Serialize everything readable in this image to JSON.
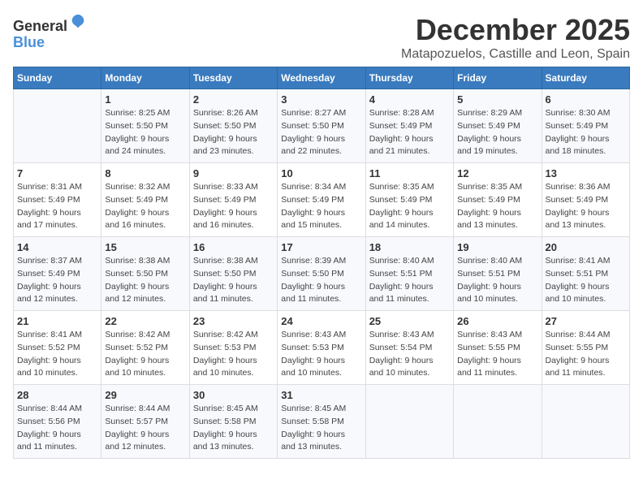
{
  "logo": {
    "line1": "General",
    "line2": "Blue"
  },
  "title": "December 2025",
  "subtitle": "Matapozuelos, Castille and Leon, Spain",
  "weekdays": [
    "Sunday",
    "Monday",
    "Tuesday",
    "Wednesday",
    "Thursday",
    "Friday",
    "Saturday"
  ],
  "weeks": [
    [
      {
        "day": "",
        "info": ""
      },
      {
        "day": "1",
        "info": "Sunrise: 8:25 AM\nSunset: 5:50 PM\nDaylight: 9 hours\nand 24 minutes."
      },
      {
        "day": "2",
        "info": "Sunrise: 8:26 AM\nSunset: 5:50 PM\nDaylight: 9 hours\nand 23 minutes."
      },
      {
        "day": "3",
        "info": "Sunrise: 8:27 AM\nSunset: 5:50 PM\nDaylight: 9 hours\nand 22 minutes."
      },
      {
        "day": "4",
        "info": "Sunrise: 8:28 AM\nSunset: 5:49 PM\nDaylight: 9 hours\nand 21 minutes."
      },
      {
        "day": "5",
        "info": "Sunrise: 8:29 AM\nSunset: 5:49 PM\nDaylight: 9 hours\nand 19 minutes."
      },
      {
        "day": "6",
        "info": "Sunrise: 8:30 AM\nSunset: 5:49 PM\nDaylight: 9 hours\nand 18 minutes."
      }
    ],
    [
      {
        "day": "7",
        "info": "Sunrise: 8:31 AM\nSunset: 5:49 PM\nDaylight: 9 hours\nand 17 minutes."
      },
      {
        "day": "8",
        "info": "Sunrise: 8:32 AM\nSunset: 5:49 PM\nDaylight: 9 hours\nand 16 minutes."
      },
      {
        "day": "9",
        "info": "Sunrise: 8:33 AM\nSunset: 5:49 PM\nDaylight: 9 hours\nand 16 minutes."
      },
      {
        "day": "10",
        "info": "Sunrise: 8:34 AM\nSunset: 5:49 PM\nDaylight: 9 hours\nand 15 minutes."
      },
      {
        "day": "11",
        "info": "Sunrise: 8:35 AM\nSunset: 5:49 PM\nDaylight: 9 hours\nand 14 minutes."
      },
      {
        "day": "12",
        "info": "Sunrise: 8:35 AM\nSunset: 5:49 PM\nDaylight: 9 hours\nand 13 minutes."
      },
      {
        "day": "13",
        "info": "Sunrise: 8:36 AM\nSunset: 5:49 PM\nDaylight: 9 hours\nand 13 minutes."
      }
    ],
    [
      {
        "day": "14",
        "info": "Sunrise: 8:37 AM\nSunset: 5:49 PM\nDaylight: 9 hours\nand 12 minutes."
      },
      {
        "day": "15",
        "info": "Sunrise: 8:38 AM\nSunset: 5:50 PM\nDaylight: 9 hours\nand 12 minutes."
      },
      {
        "day": "16",
        "info": "Sunrise: 8:38 AM\nSunset: 5:50 PM\nDaylight: 9 hours\nand 11 minutes."
      },
      {
        "day": "17",
        "info": "Sunrise: 8:39 AM\nSunset: 5:50 PM\nDaylight: 9 hours\nand 11 minutes."
      },
      {
        "day": "18",
        "info": "Sunrise: 8:40 AM\nSunset: 5:51 PM\nDaylight: 9 hours\nand 11 minutes."
      },
      {
        "day": "19",
        "info": "Sunrise: 8:40 AM\nSunset: 5:51 PM\nDaylight: 9 hours\nand 10 minutes."
      },
      {
        "day": "20",
        "info": "Sunrise: 8:41 AM\nSunset: 5:51 PM\nDaylight: 9 hours\nand 10 minutes."
      }
    ],
    [
      {
        "day": "21",
        "info": "Sunrise: 8:41 AM\nSunset: 5:52 PM\nDaylight: 9 hours\nand 10 minutes."
      },
      {
        "day": "22",
        "info": "Sunrise: 8:42 AM\nSunset: 5:52 PM\nDaylight: 9 hours\nand 10 minutes."
      },
      {
        "day": "23",
        "info": "Sunrise: 8:42 AM\nSunset: 5:53 PM\nDaylight: 9 hours\nand 10 minutes."
      },
      {
        "day": "24",
        "info": "Sunrise: 8:43 AM\nSunset: 5:53 PM\nDaylight: 9 hours\nand 10 minutes."
      },
      {
        "day": "25",
        "info": "Sunrise: 8:43 AM\nSunset: 5:54 PM\nDaylight: 9 hours\nand 10 minutes."
      },
      {
        "day": "26",
        "info": "Sunrise: 8:43 AM\nSunset: 5:55 PM\nDaylight: 9 hours\nand 11 minutes."
      },
      {
        "day": "27",
        "info": "Sunrise: 8:44 AM\nSunset: 5:55 PM\nDaylight: 9 hours\nand 11 minutes."
      }
    ],
    [
      {
        "day": "28",
        "info": "Sunrise: 8:44 AM\nSunset: 5:56 PM\nDaylight: 9 hours\nand 11 minutes."
      },
      {
        "day": "29",
        "info": "Sunrise: 8:44 AM\nSunset: 5:57 PM\nDaylight: 9 hours\nand 12 minutes."
      },
      {
        "day": "30",
        "info": "Sunrise: 8:45 AM\nSunset: 5:58 PM\nDaylight: 9 hours\nand 13 minutes."
      },
      {
        "day": "31",
        "info": "Sunrise: 8:45 AM\nSunset: 5:58 PM\nDaylight: 9 hours\nand 13 minutes."
      },
      {
        "day": "",
        "info": ""
      },
      {
        "day": "",
        "info": ""
      },
      {
        "day": "",
        "info": ""
      }
    ]
  ]
}
